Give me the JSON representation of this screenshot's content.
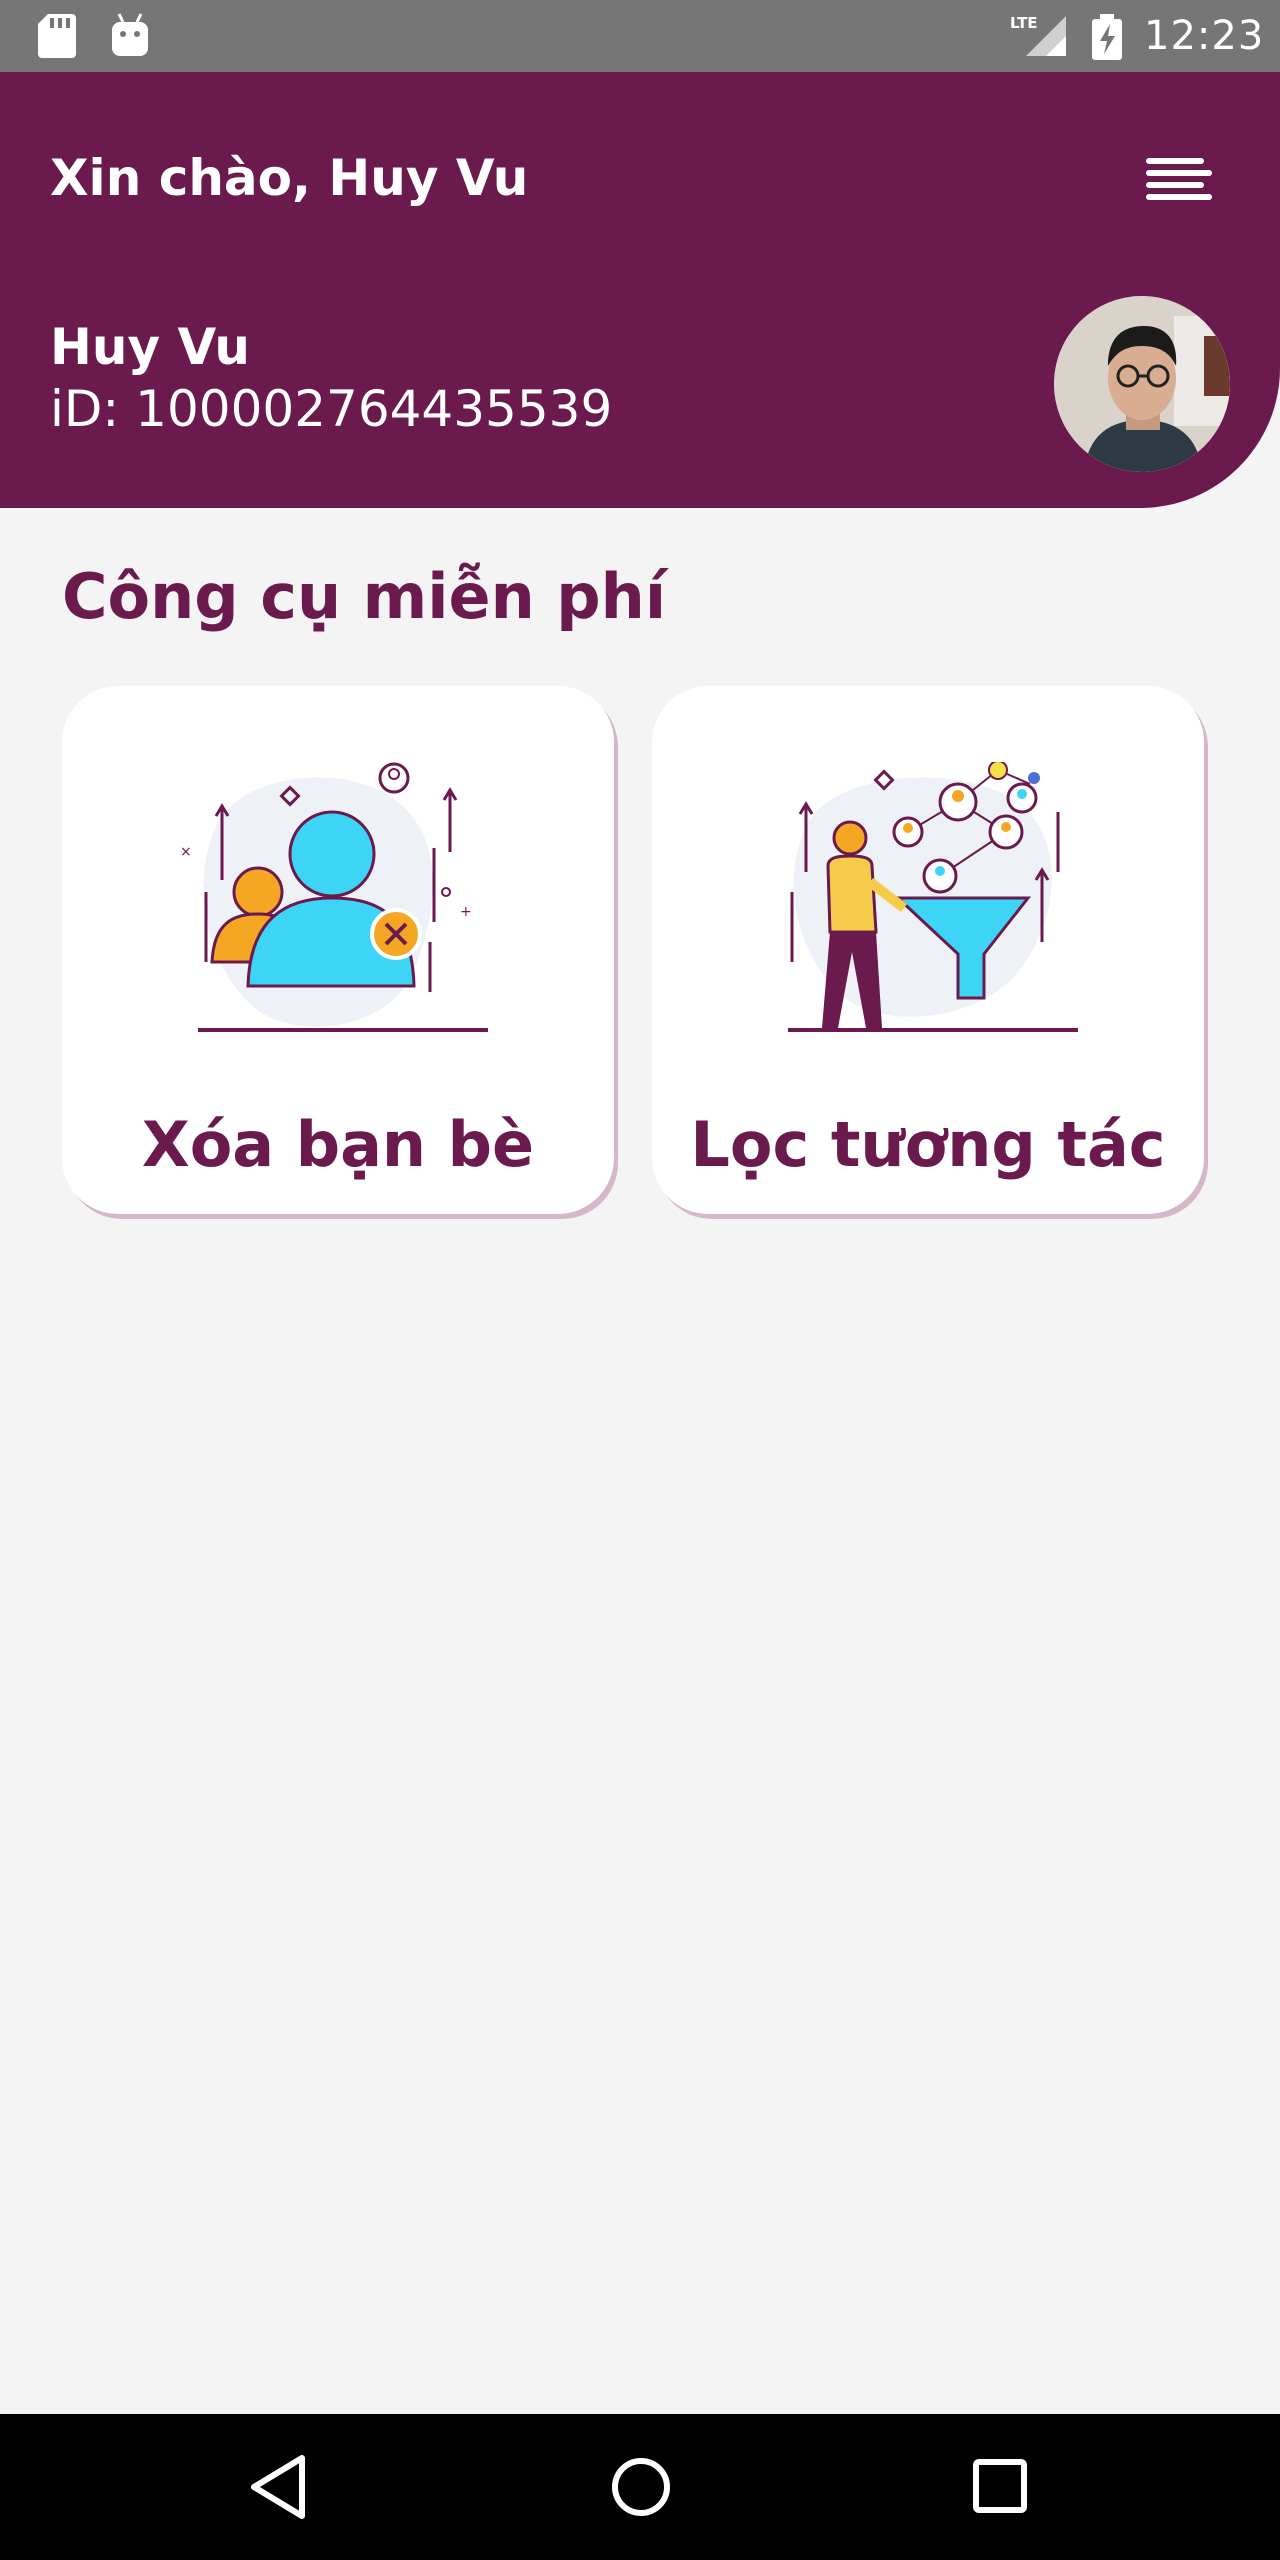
{
  "status_bar": {
    "time": "12:23",
    "network": "LTE",
    "icons": [
      "sd-card-icon",
      "android-icon",
      "lte-signal-icon",
      "battery-charging-icon"
    ]
  },
  "header": {
    "greeting": "Xin chào, Huy Vu",
    "user_name": "Huy Vu",
    "user_id": "iD: 100002764435539",
    "menu_icon": "menu-icon",
    "background_color": "#6b1a4e"
  },
  "section": {
    "title": "Công cụ miễn phí"
  },
  "tools": [
    {
      "label": "Xóa bạn bè",
      "icon": "remove-friends-illustration"
    },
    {
      "label": "Lọc tương tác",
      "icon": "filter-interaction-illustration"
    }
  ],
  "nav_bar": {
    "icons": [
      "back-icon",
      "home-icon",
      "recents-icon"
    ]
  },
  "colors": {
    "primary": "#6b1a4e",
    "accent_blue": "#3dd4f5",
    "accent_orange": "#f5a623",
    "background": "#f4f4f4"
  }
}
